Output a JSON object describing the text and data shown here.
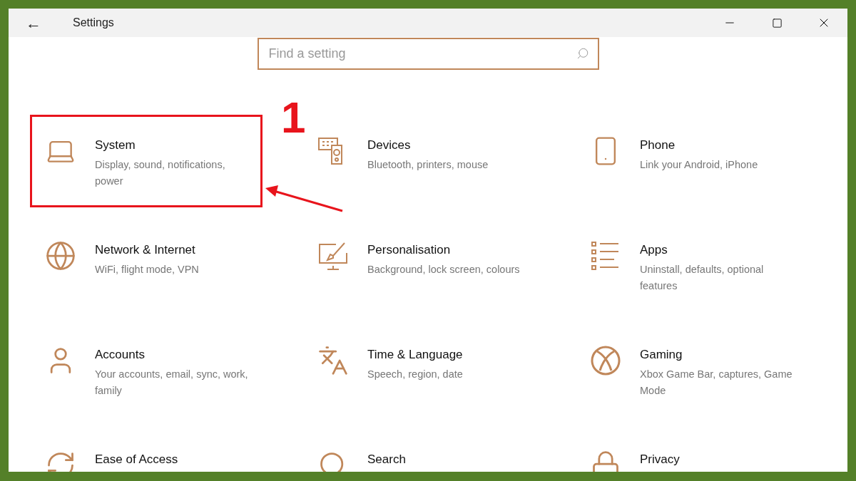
{
  "window": {
    "title": "Settings",
    "back": "←"
  },
  "search": {
    "placeholder": "Find a setting"
  },
  "annotation": {
    "label": "1"
  },
  "tiles": [
    {
      "kind": "laptop",
      "title": "System",
      "description": "Display, sound, notifications, power",
      "highlighted": true
    },
    {
      "kind": "devices",
      "title": "Devices",
      "description": "Bluetooth, printers, mouse",
      "highlighted": false
    },
    {
      "kind": "phone",
      "title": "Phone",
      "description": "Link your Android, iPhone",
      "highlighted": false
    },
    {
      "kind": "globe",
      "title": "Network & Internet",
      "description": "WiFi, flight mode, VPN",
      "highlighted": false
    },
    {
      "kind": "paint",
      "title": "Personalisation",
      "description": "Background, lock screen, colours",
      "highlighted": false
    },
    {
      "kind": "list",
      "title": "Apps",
      "description": "Uninstall, defaults, optional features",
      "highlighted": false
    },
    {
      "kind": "person",
      "title": "Accounts",
      "description": "Your accounts, email, sync, work, family",
      "highlighted": false
    },
    {
      "kind": "language",
      "title": "Time & Language",
      "description": "Speech, region, date",
      "highlighted": false
    },
    {
      "kind": "xbox",
      "title": "Gaming",
      "description": "Xbox Game Bar, captures, Game Mode",
      "highlighted": false
    },
    {
      "kind": "access",
      "title": "Ease of Access",
      "highlighted": false
    },
    {
      "kind": "search",
      "title": "Search",
      "highlighted": false
    },
    {
      "kind": "lock",
      "title": "Privacy",
      "highlighted": false
    }
  ]
}
